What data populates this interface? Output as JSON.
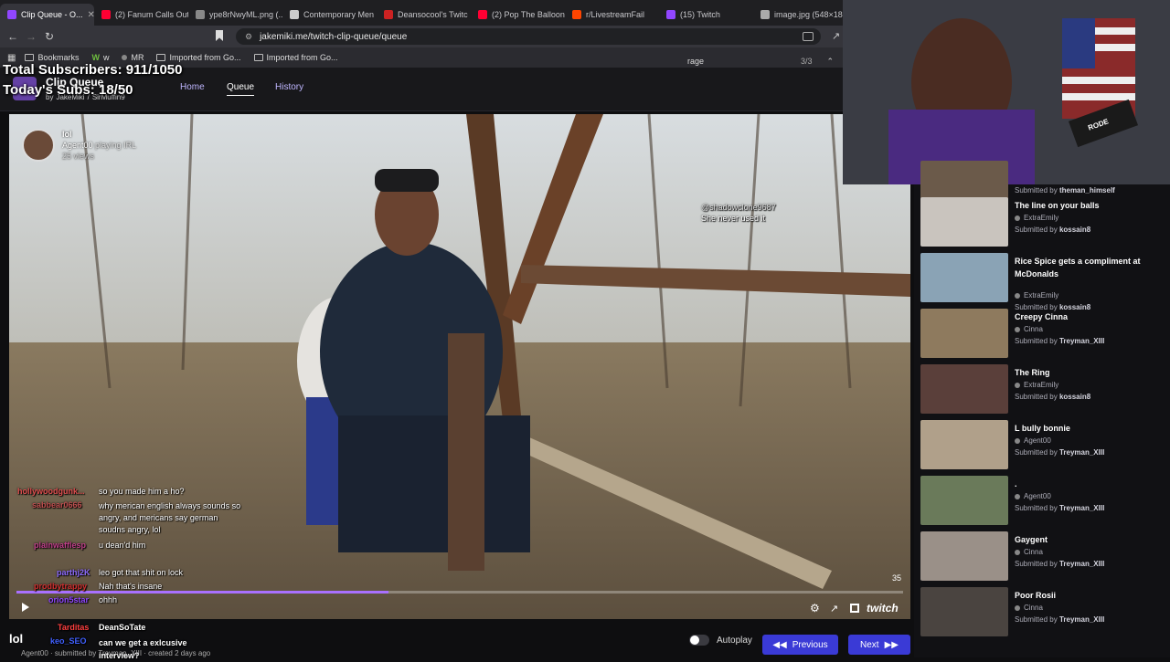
{
  "browser": {
    "tabs": [
      {
        "label": "Clip Queue - O...",
        "color": "#9146ff",
        "active": true
      },
      {
        "label": "(2) Fanum Calls Out",
        "color": "#ff0033"
      },
      {
        "label": "ype8rNwyML.png (...",
        "color": "#888888"
      },
      {
        "label": "Contemporary Men",
        "color": "#cccccc"
      },
      {
        "label": "Deansocool's Twitc",
        "color": "#cc2222"
      },
      {
        "label": "(2) Pop The Balloon",
        "color": "#ff0033"
      },
      {
        "label": "r/LivestreamFail",
        "color": "#ff4500"
      },
      {
        "label": "(15) Twitch",
        "color": "#9146ff"
      },
      {
        "label": "image.jpg (548×18",
        "color": "#aaaaaa"
      }
    ],
    "url": "jakemiki.me/twitch-clip-queue/queue",
    "bookmarks": [
      "Bookmarks",
      "w",
      "MR",
      "Imported from Go...",
      "Imported from Go..."
    ],
    "find": {
      "query": "rage",
      "count": "3/3"
    }
  },
  "overlay": {
    "total_subscribers": "Total Subscribers: 911/1050",
    "todays_subs": "Today's Subs: 18/50"
  },
  "app": {
    "title": "Clip Queue",
    "by": "by",
    "author1": "JakeMiki",
    "author2": "SirMuffin9",
    "nav": [
      "Home",
      "Queue",
      "History"
    ]
  },
  "player": {
    "clip_title": "lol",
    "channel": "Agent00",
    "playing": "playing IRL",
    "views": "25 views",
    "counter": "35",
    "brand": "twitch",
    "progress": 0.42
  },
  "chat_top": [
    {
      "user": "@shadowclone9687",
      "text": "She never used it"
    }
  ],
  "chat_bottom": [
    {
      "user": "hollywoodgunk...",
      "text": "so you made him a ho?",
      "color": "#e05050"
    },
    {
      "user": "sabbear0666",
      "text": "why merican english always sounds so angry, and mericans say german soudns angry, lol",
      "color": "#c05050"
    },
    {
      "user": "plainwafflesp",
      "text": "u dean'd him",
      "color": "#c0408a"
    },
    {
      "user": "parthj2K",
      "text": "leo got that shit on lock",
      "color": "#8e6cff"
    },
    {
      "user": "prodbytrappy",
      "text": "Nah that's insane",
      "color": "#d03030"
    },
    {
      "user": "orion5star",
      "text": "ohhh",
      "color": "#9146ff"
    },
    {
      "user": "Tarditas",
      "text": "DeanSoTate",
      "color": "#ff4040"
    },
    {
      "user": "keo_SEO",
      "text": "can we get a exlcusive interview?",
      "color": "#4060ff"
    }
  ],
  "footer": {
    "title": "lol",
    "meta": "Agent00 · submitted by Treyman_XIII · created 2 days ago",
    "autoplay": "Autoplay",
    "previous": "Previous",
    "next": "Next"
  },
  "queue": [
    {
      "title": "",
      "channel": "",
      "submitter": "theman_himself",
      "thumb": "#6b5a4a"
    },
    {
      "title": "The line on your balls",
      "channel": "ExtraEmily",
      "submitter": "kossain8",
      "thumb": "#c9c4be"
    },
    {
      "title": "Rice Spice gets a compliment at McDonalds",
      "channel": "ExtraEmily",
      "submitter": "kossain8",
      "thumb": "#8aa3b5"
    },
    {
      "title": "Creepy Cinna",
      "channel": "Cinna",
      "submitter": "Treyman_XIII",
      "thumb": "#8e7a5e"
    },
    {
      "title": "The Ring",
      "channel": "ExtraEmily",
      "submitter": "kossain8",
      "thumb": "#5a3f3a"
    },
    {
      "title": "L bully bonnie",
      "channel": "Agent00",
      "submitter": "Treyman_XIII",
      "thumb": "#b0a08a"
    },
    {
      "title": ".",
      "channel": "Agent00",
      "submitter": "Treyman_XIII",
      "thumb": "#6a7a5a"
    },
    {
      "title": "Gaygent",
      "channel": "Cinna",
      "submitter": "Treyman_XIII",
      "thumb": "#9a9088"
    },
    {
      "title": "Poor Rosii",
      "channel": "Cinna",
      "submitter": "Treyman_XIII",
      "thumb": "#4a4440"
    }
  ],
  "submitted_by": "Submitted by",
  "webcam": {
    "mic_brand": "RODE"
  }
}
